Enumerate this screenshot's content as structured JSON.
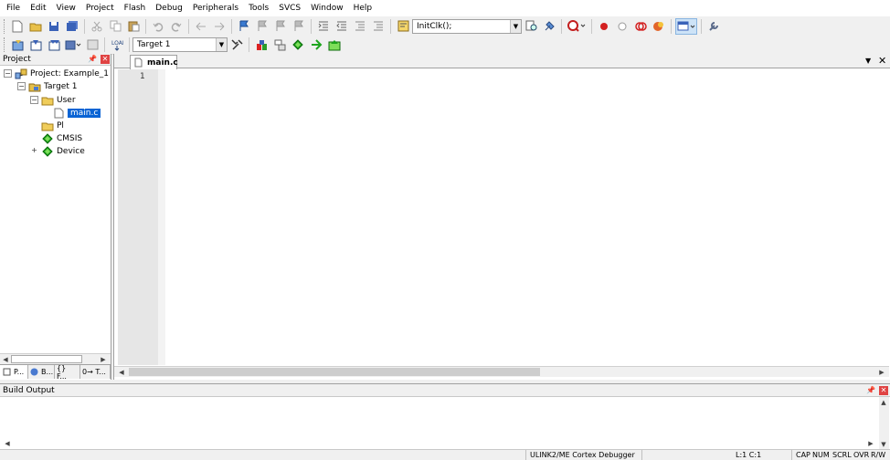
{
  "menu": [
    "File",
    "Edit",
    "View",
    "Project",
    "Flash",
    "Debug",
    "Peripherals",
    "Tools",
    "SVCS",
    "Window",
    "Help"
  ],
  "toolbar": {
    "find_combo_value": "InitClk();"
  },
  "build_toolbar": {
    "target_select": "Target 1"
  },
  "project_panel": {
    "title": "Project",
    "tree": {
      "project": "Project: Example_1",
      "target": "Target 1",
      "user_group": "User",
      "file": "main.c",
      "pl_folder": "Pl",
      "cmsis": "CMSIS",
      "device": "Device"
    },
    "tabs": [
      "P...",
      "B...",
      "{} F...",
      "0→ T..."
    ]
  },
  "editor": {
    "tab": "main.c",
    "line_numbers": [
      "1"
    ]
  },
  "build_output": {
    "title": "Build Output"
  },
  "status": {
    "debugger": "ULINK2/ME Cortex Debugger",
    "cursor": "L:1 C:1",
    "caps": "CAP",
    "num": "NUM",
    "scrl": "SCRL",
    "ovr": "OVR",
    "rw": "R/W"
  },
  "colors": {
    "selection": "#0a64d4",
    "close": "#e04343",
    "diamond": "#1ea51e"
  }
}
